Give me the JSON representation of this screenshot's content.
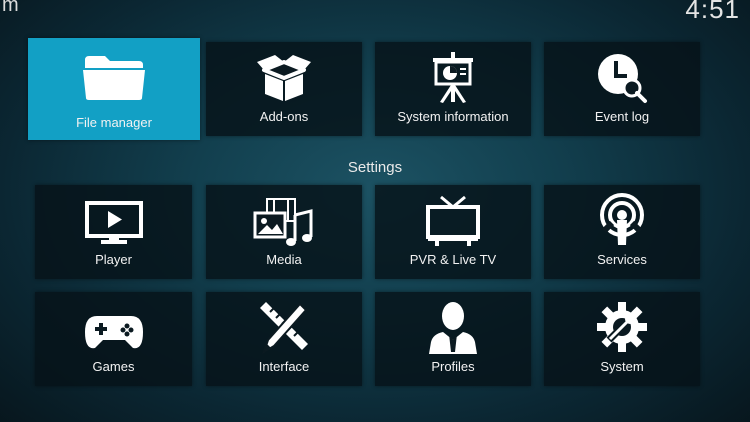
{
  "header": {
    "title_fragment": "m",
    "clock": "4:51"
  },
  "top_row": [
    {
      "label": "File manager",
      "icon": "folder-icon",
      "focused": true
    },
    {
      "label": "Add-ons",
      "icon": "open-box-icon",
      "focused": false
    },
    {
      "label": "System information",
      "icon": "presentation-board-icon",
      "focused": false
    },
    {
      "label": "Event log",
      "icon": "clock-search-icon",
      "focused": false
    }
  ],
  "settings": {
    "title": "Settings",
    "items": [
      {
        "label": "Player",
        "icon": "monitor-play-icon"
      },
      {
        "label": "Media",
        "icon": "media-library-icon"
      },
      {
        "label": "PVR & Live TV",
        "icon": "tv-antenna-icon"
      },
      {
        "label": "Services",
        "icon": "broadcast-icon"
      },
      {
        "label": "Games",
        "icon": "gamepad-icon"
      },
      {
        "label": "Interface",
        "icon": "pencil-ruler-icon"
      },
      {
        "label": "Profiles",
        "icon": "user-icon"
      },
      {
        "label": "System",
        "icon": "gear-wrench-icon"
      }
    ]
  },
  "colors": {
    "focus_accent": "#12a0c5",
    "tile_background": "#061218"
  }
}
